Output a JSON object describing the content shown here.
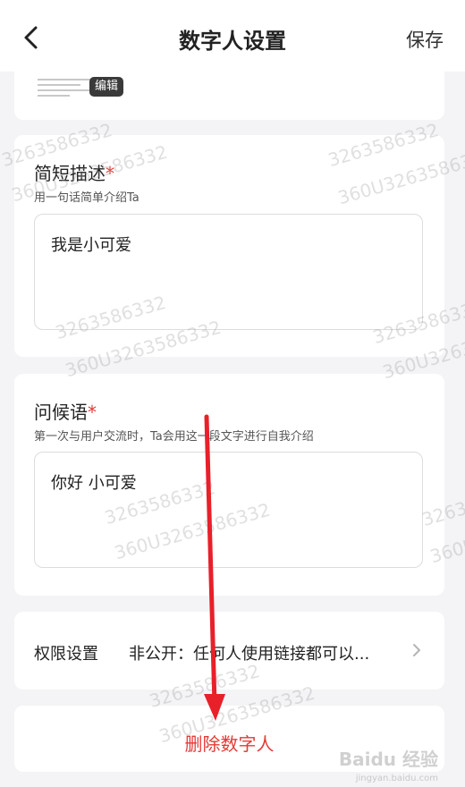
{
  "header": {
    "title": "数字人设置",
    "save_label": "保存",
    "back_icon": "chevron-left-icon"
  },
  "avatar_card": {
    "edit_label": "编辑"
  },
  "description": {
    "label": "简短描述",
    "required_mark": "*",
    "hint": "用一句话简单介绍Ta",
    "value": "我是小可爱"
  },
  "greeting": {
    "label": "问候语",
    "required_mark": "*",
    "hint": "第一次与用户交流时，Ta会用这一段文字进行自我介绍",
    "value": "你好 小可爱"
  },
  "permission": {
    "label": "权限设置",
    "value": "非公开：任何人使用链接都可以...",
    "chevron_icon": "chevron-right-icon"
  },
  "delete_label": "删除数字人",
  "watermarks": [
    "3263586332",
    "360U3263586332"
  ],
  "baidu_mark": {
    "logo": "Baidu 经验",
    "url": "jingyan.baidu.com"
  },
  "colors": {
    "accent_red": "#e53935",
    "background": "#f4f4f6",
    "card": "#ffffff"
  }
}
